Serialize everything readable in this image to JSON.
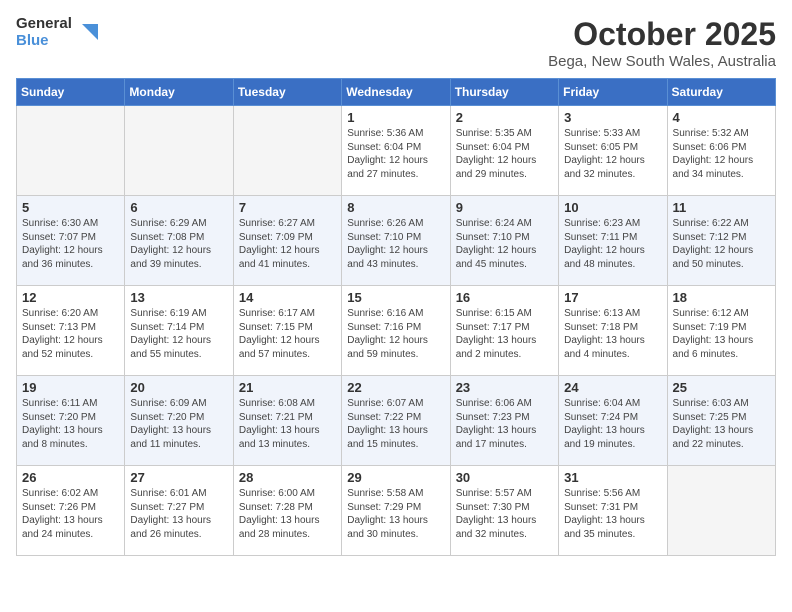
{
  "header": {
    "logo_general": "General",
    "logo_blue": "Blue",
    "month_title": "October 2025",
    "location": "Bega, New South Wales, Australia"
  },
  "weekdays": [
    "Sunday",
    "Monday",
    "Tuesday",
    "Wednesday",
    "Thursday",
    "Friday",
    "Saturday"
  ],
  "weeks": [
    [
      {
        "day": "",
        "info": ""
      },
      {
        "day": "",
        "info": ""
      },
      {
        "day": "",
        "info": ""
      },
      {
        "day": "1",
        "info": "Sunrise: 5:36 AM\nSunset: 6:04 PM\nDaylight: 12 hours\nand 27 minutes."
      },
      {
        "day": "2",
        "info": "Sunrise: 5:35 AM\nSunset: 6:04 PM\nDaylight: 12 hours\nand 29 minutes."
      },
      {
        "day": "3",
        "info": "Sunrise: 5:33 AM\nSunset: 6:05 PM\nDaylight: 12 hours\nand 32 minutes."
      },
      {
        "day": "4",
        "info": "Sunrise: 5:32 AM\nSunset: 6:06 PM\nDaylight: 12 hours\nand 34 minutes."
      }
    ],
    [
      {
        "day": "5",
        "info": "Sunrise: 6:30 AM\nSunset: 7:07 PM\nDaylight: 12 hours\nand 36 minutes."
      },
      {
        "day": "6",
        "info": "Sunrise: 6:29 AM\nSunset: 7:08 PM\nDaylight: 12 hours\nand 39 minutes."
      },
      {
        "day": "7",
        "info": "Sunrise: 6:27 AM\nSunset: 7:09 PM\nDaylight: 12 hours\nand 41 minutes."
      },
      {
        "day": "8",
        "info": "Sunrise: 6:26 AM\nSunset: 7:10 PM\nDaylight: 12 hours\nand 43 minutes."
      },
      {
        "day": "9",
        "info": "Sunrise: 6:24 AM\nSunset: 7:10 PM\nDaylight: 12 hours\nand 45 minutes."
      },
      {
        "day": "10",
        "info": "Sunrise: 6:23 AM\nSunset: 7:11 PM\nDaylight: 12 hours\nand 48 minutes."
      },
      {
        "day": "11",
        "info": "Sunrise: 6:22 AM\nSunset: 7:12 PM\nDaylight: 12 hours\nand 50 minutes."
      }
    ],
    [
      {
        "day": "12",
        "info": "Sunrise: 6:20 AM\nSunset: 7:13 PM\nDaylight: 12 hours\nand 52 minutes."
      },
      {
        "day": "13",
        "info": "Sunrise: 6:19 AM\nSunset: 7:14 PM\nDaylight: 12 hours\nand 55 minutes."
      },
      {
        "day": "14",
        "info": "Sunrise: 6:17 AM\nSunset: 7:15 PM\nDaylight: 12 hours\nand 57 minutes."
      },
      {
        "day": "15",
        "info": "Sunrise: 6:16 AM\nSunset: 7:16 PM\nDaylight: 12 hours\nand 59 minutes."
      },
      {
        "day": "16",
        "info": "Sunrise: 6:15 AM\nSunset: 7:17 PM\nDaylight: 13 hours\nand 2 minutes."
      },
      {
        "day": "17",
        "info": "Sunrise: 6:13 AM\nSunset: 7:18 PM\nDaylight: 13 hours\nand 4 minutes."
      },
      {
        "day": "18",
        "info": "Sunrise: 6:12 AM\nSunset: 7:19 PM\nDaylight: 13 hours\nand 6 minutes."
      }
    ],
    [
      {
        "day": "19",
        "info": "Sunrise: 6:11 AM\nSunset: 7:20 PM\nDaylight: 13 hours\nand 8 minutes."
      },
      {
        "day": "20",
        "info": "Sunrise: 6:09 AM\nSunset: 7:20 PM\nDaylight: 13 hours\nand 11 minutes."
      },
      {
        "day": "21",
        "info": "Sunrise: 6:08 AM\nSunset: 7:21 PM\nDaylight: 13 hours\nand 13 minutes."
      },
      {
        "day": "22",
        "info": "Sunrise: 6:07 AM\nSunset: 7:22 PM\nDaylight: 13 hours\nand 15 minutes."
      },
      {
        "day": "23",
        "info": "Sunrise: 6:06 AM\nSunset: 7:23 PM\nDaylight: 13 hours\nand 17 minutes."
      },
      {
        "day": "24",
        "info": "Sunrise: 6:04 AM\nSunset: 7:24 PM\nDaylight: 13 hours\nand 19 minutes."
      },
      {
        "day": "25",
        "info": "Sunrise: 6:03 AM\nSunset: 7:25 PM\nDaylight: 13 hours\nand 22 minutes."
      }
    ],
    [
      {
        "day": "26",
        "info": "Sunrise: 6:02 AM\nSunset: 7:26 PM\nDaylight: 13 hours\nand 24 minutes."
      },
      {
        "day": "27",
        "info": "Sunrise: 6:01 AM\nSunset: 7:27 PM\nDaylight: 13 hours\nand 26 minutes."
      },
      {
        "day": "28",
        "info": "Sunrise: 6:00 AM\nSunset: 7:28 PM\nDaylight: 13 hours\nand 28 minutes."
      },
      {
        "day": "29",
        "info": "Sunrise: 5:58 AM\nSunset: 7:29 PM\nDaylight: 13 hours\nand 30 minutes."
      },
      {
        "day": "30",
        "info": "Sunrise: 5:57 AM\nSunset: 7:30 PM\nDaylight: 13 hours\nand 32 minutes."
      },
      {
        "day": "31",
        "info": "Sunrise: 5:56 AM\nSunset: 7:31 PM\nDaylight: 13 hours\nand 35 minutes."
      },
      {
        "day": "",
        "info": ""
      }
    ]
  ]
}
